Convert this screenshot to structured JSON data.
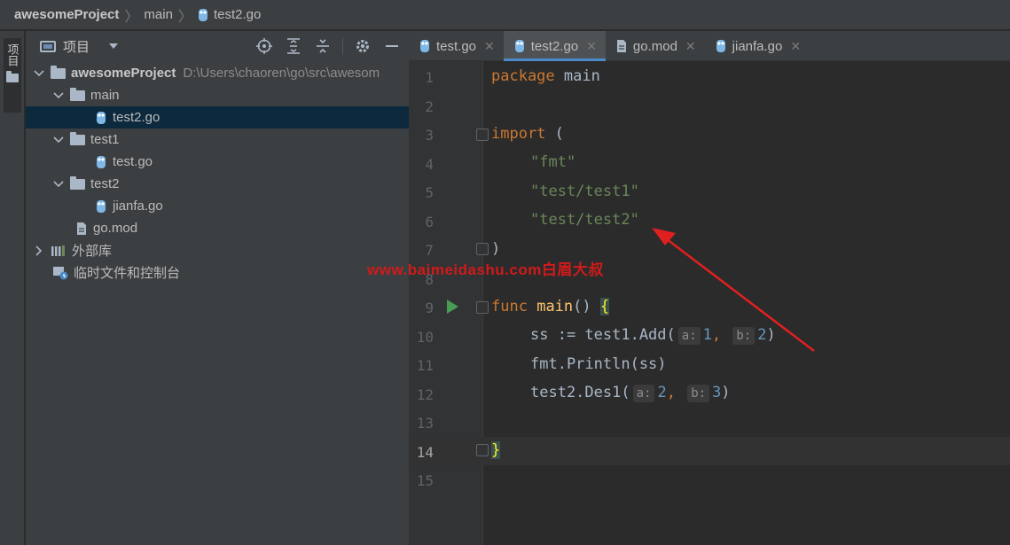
{
  "breadcrumb": {
    "project": "awesomeProject",
    "folder": "main",
    "file": "test2.go"
  },
  "stripe": {
    "label": "项目"
  },
  "project_panel": {
    "title": "项目",
    "tree": [
      {
        "label": "awesomeProject",
        "hint": "D:\\Users\\chaoren\\go\\src\\awesom"
      },
      {
        "label": "main"
      },
      {
        "label": "test2.go"
      },
      {
        "label": "test1"
      },
      {
        "label": "test.go"
      },
      {
        "label": "test2"
      },
      {
        "label": "jianfa.go"
      },
      {
        "label": "go.mod"
      },
      {
        "label": "外部库"
      },
      {
        "label": "临时文件和控制台"
      }
    ]
  },
  "editor_tabs": [
    {
      "label": "test.go"
    },
    {
      "label": "test2.go"
    },
    {
      "label": "go.mod"
    },
    {
      "label": "jianfa.go"
    }
  ],
  "code": {
    "line_numbers": [
      "1",
      "2",
      "3",
      "4",
      "5",
      "6",
      "7",
      "8",
      "9",
      "10",
      "11",
      "12",
      "13",
      "14",
      "15"
    ],
    "l1_kw": "package",
    "l1_name": " main",
    "l3_kw": "import",
    "l3_rest": " (",
    "l4": "\"fmt\"",
    "l5": "\"test/test1\"",
    "l6": "\"test/test2\"",
    "l7": ")",
    "l9_kw": "func",
    "l9_fn": "main",
    "l9_rest": "() ",
    "l9_brace": "{",
    "l10_a": "ss := test1.Add(",
    "l10_hint1": "a:",
    "l10_v1": "1",
    "l10_sep": ", ",
    "l10_hint2": "b:",
    "l10_v2": "2",
    "l10_end": ")",
    "l11": "fmt.Println(ss)",
    "l12_a": "test2.Des1(",
    "l12_hint1": "a:",
    "l12_v1": "2",
    "l12_sep": ", ",
    "l12_hint2": "b:",
    "l12_v2": "3",
    "l12_end": ")",
    "l14": "}"
  },
  "watermark": "www.baimeidashu.com白眉大叔",
  "colors": {
    "annotation_arrow": "#e02020",
    "selection": "#0d293e",
    "tab_underline": "#4a88c7"
  }
}
